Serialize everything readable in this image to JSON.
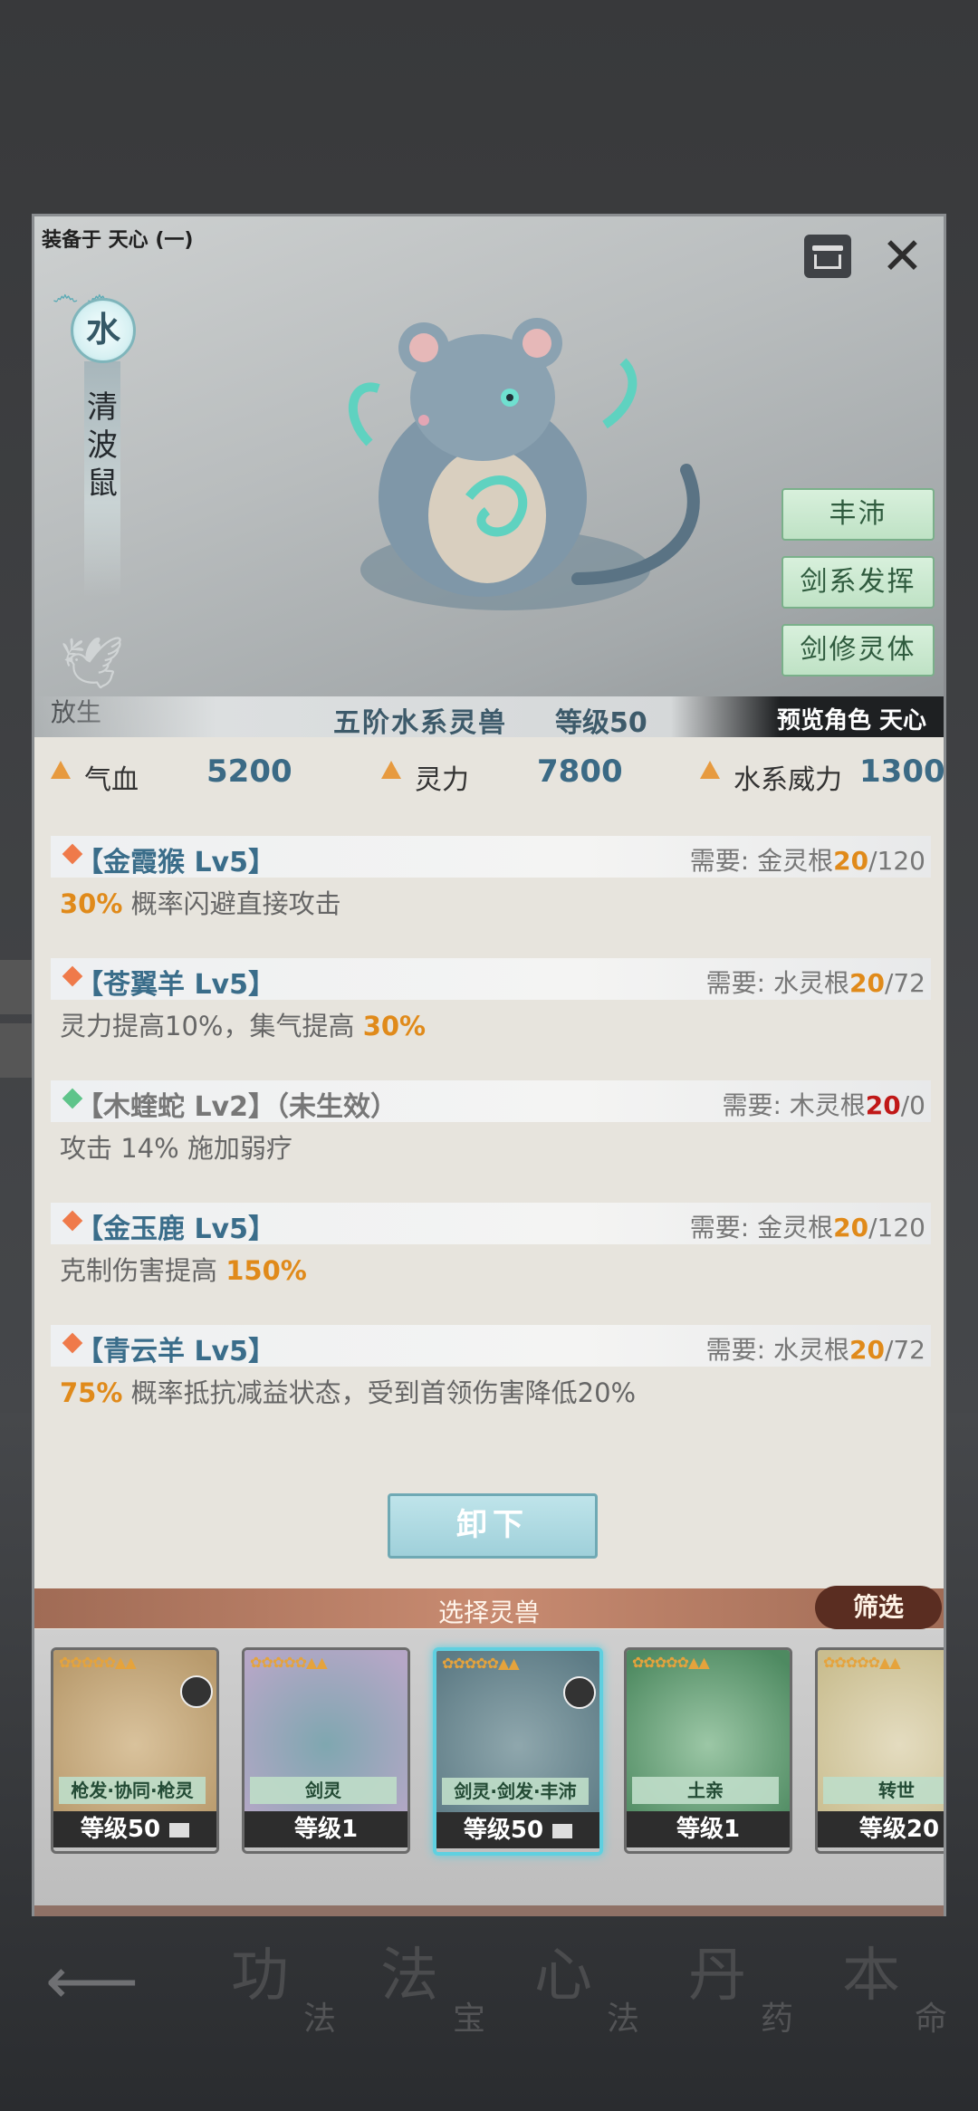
{
  "hero": {
    "equipped_label": "装备于 天心 (一)",
    "element": "水",
    "beast_name": "清\n波\n鼠",
    "release_label": "放生",
    "grade": "五阶水系灵兽",
    "level": "等级50",
    "preview": "预览角色 天心",
    "trait_buttons": [
      "丰沛",
      "剑系发挥",
      "剑修灵体"
    ]
  },
  "stats": [
    {
      "label": "气血",
      "value": "5200"
    },
    {
      "label": "灵力",
      "value": "7800"
    },
    {
      "label": "水系威力",
      "value": "1300"
    }
  ],
  "skills": [
    {
      "icon_color": "#ef7a4a",
      "name": "【金霞猴 Lv5】",
      "req_prefix": "需要: 金灵根",
      "req_have": "20",
      "req_total": "/120",
      "desc_parts": [
        [
          "30%",
          "hl"
        ],
        [
          " 概率闪避直接攻击",
          ""
        ]
      ]
    },
    {
      "icon_color": "#ef7a4a",
      "name": "【苍翼羊 Lv5】",
      "req_prefix": "需要: 水灵根",
      "req_have": "20",
      "req_total": "/72",
      "desc_parts": [
        [
          "灵力提高10%，集气提高 ",
          ""
        ],
        [
          "30%",
          "hl"
        ]
      ]
    },
    {
      "icon_color": "#5ec48a",
      "name": "【木蝰蛇 Lv2】（未生效）",
      "req_prefix": "需要: 木灵根",
      "req_have": "20",
      "req_total": "/0",
      "desc_parts": [
        [
          "攻击 14% 施加弱疗",
          ""
        ]
      ],
      "inactive": true
    },
    {
      "icon_color": "#ef7a4a",
      "name": "【金玉鹿 Lv5】",
      "req_prefix": "需要: 金灵根",
      "req_have": "20",
      "req_total": "/120",
      "desc_parts": [
        [
          "克制伤害提高 ",
          ""
        ],
        [
          "150%",
          "hl"
        ]
      ]
    },
    {
      "icon_color": "#ef7a4a",
      "name": "【青云羊 Lv5】",
      "req_prefix": "需要: 水灵根",
      "req_have": "20",
      "req_total": "/72",
      "desc_parts": [
        [
          "75%",
          "hl"
        ],
        [
          " 概率抵抗减益状态，受到首领伤害降低20%",
          ""
        ]
      ]
    }
  ],
  "unequip_label": "卸下",
  "select_title": "选择灵兽",
  "filter_label": "筛选",
  "cards": [
    {
      "tag": "枪发·协同·枪灵",
      "level": "等级50",
      "locked": true,
      "colors": [
        "#d9c29c",
        "#b89a6c"
      ]
    },
    {
      "tag": "剑灵",
      "level": "等级1",
      "locked": false,
      "colors": [
        "#7fa7b0",
        "#b6a7c7"
      ]
    },
    {
      "tag": "剑灵·剑发·丰沛",
      "level": "等级50",
      "locked": true,
      "selected": true,
      "colors": [
        "#8fa7ad",
        "#5d7b85"
      ]
    },
    {
      "tag": "土亲",
      "level": "等级1",
      "locked": false,
      "colors": [
        "#9cc7a6",
        "#4e8a61"
      ]
    },
    {
      "tag": "转世",
      "level": "等级20",
      "locked": false,
      "colors": [
        "#e4dcc0",
        "#c9bd8f"
      ]
    }
  ],
  "bottom_nav": [
    {
      "big": "功",
      "small": "法"
    },
    {
      "big": "法",
      "small": "宝"
    },
    {
      "big": "心",
      "small": "法"
    },
    {
      "big": "丹",
      "small": "药"
    },
    {
      "big": "本",
      "small": "命"
    }
  ],
  "colors": {
    "accent_orange": "#e08a1a",
    "stat_blue": "#3b6a85",
    "select_bar": "#c88b71"
  }
}
